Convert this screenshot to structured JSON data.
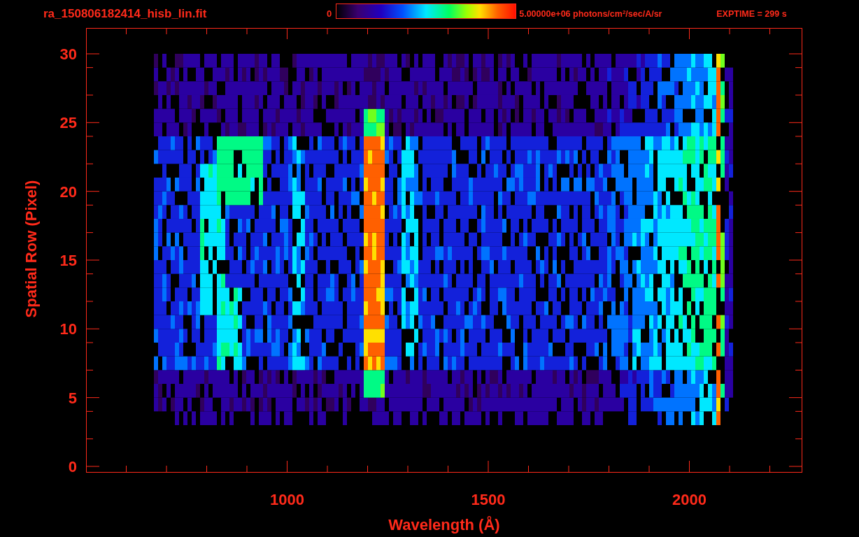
{
  "title": "ra_150806182414_hisb_lin.fit",
  "colorbar": {
    "min_label": "0",
    "max_label": "5.00000e+06 photons/cm$^{2}$/sec/A/sr"
  },
  "exposure": "EXPTIME = 299 s",
  "plot": {
    "x_axis": {
      "title": "Wavelength (Å)",
      "tick_labels": [
        "1000",
        "1500",
        "2000"
      ]
    },
    "y_axis": {
      "title": "Spatial Row (Pixel)",
      "tick_labels": [
        "30",
        "25",
        "20",
        "15",
        "10",
        "5",
        "0"
      ]
    }
  }
}
